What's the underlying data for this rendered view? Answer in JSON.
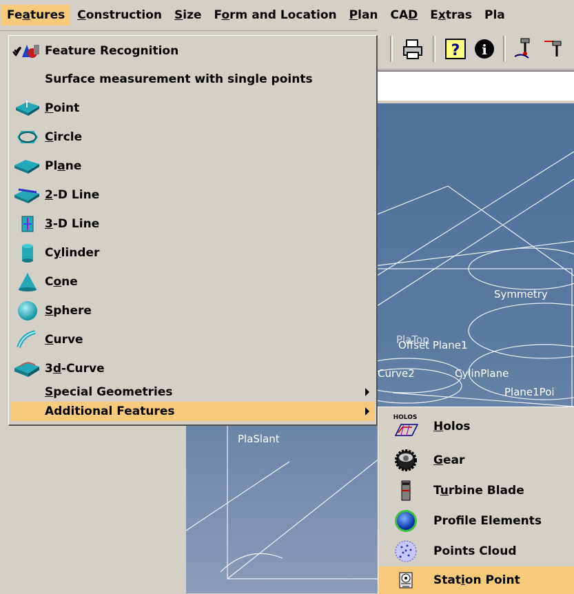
{
  "menubar": {
    "items": [
      {
        "label": "Features"
      },
      {
        "label": "Construction"
      },
      {
        "label": "Size"
      },
      {
        "label": "Form and Location"
      },
      {
        "label": "Plan"
      },
      {
        "label": "CAD"
      },
      {
        "label": "Extras"
      },
      {
        "label": "Pla"
      }
    ]
  },
  "features_menu": {
    "items": [
      {
        "label": "Feature Recognition",
        "checked": true,
        "icon": "feature-recognition-icon"
      },
      {
        "label": "Surface measurement with single points",
        "icon": ""
      },
      {
        "label": "Point",
        "icon": "point-icon"
      },
      {
        "label": "Circle",
        "icon": "circle-icon"
      },
      {
        "label": "Plane",
        "icon": "plane-icon"
      },
      {
        "label": "2-D Line",
        "icon": "2d-line-icon"
      },
      {
        "label": "3-D Line",
        "icon": "3d-line-icon"
      },
      {
        "label": "Cylinder",
        "icon": "cylinder-icon"
      },
      {
        "label": "Cone",
        "icon": "cone-icon"
      },
      {
        "label": "Sphere",
        "icon": "sphere-icon"
      },
      {
        "label": "Curve",
        "icon": "curve-icon"
      },
      {
        "label": "3d-Curve",
        "icon": "3d-curve-icon"
      },
      {
        "label": "Special Geometries",
        "submenu": true
      },
      {
        "label": "Additional Features",
        "submenu": true,
        "highlighted": true
      }
    ]
  },
  "additional_features_submenu": {
    "items": [
      {
        "label": "Holos",
        "icon": "holos-icon",
        "icon_text": "HOLOS"
      },
      {
        "label": "Gear",
        "icon": "gear-icon"
      },
      {
        "label": "Turbine Blade",
        "icon": "turbine-blade-icon"
      },
      {
        "label": "Profile Elements",
        "icon": "profile-elements-icon"
      },
      {
        "label": "Points Cloud",
        "icon": "points-cloud-icon"
      },
      {
        "label": "Station Point",
        "icon": "station-point-icon",
        "highlighted": true
      }
    ]
  },
  "cad_view": {
    "labels": [
      "Symmetry",
      "Offset Plane1",
      "Curve2",
      "CylinPlane",
      "Plane1Poi",
      "PlaSlant",
      "PlaTop"
    ]
  },
  "colors": {
    "highlight": "#f7c97a",
    "menu_bg": "#d4d0c8",
    "cad_bg": "#4f6f9a"
  }
}
